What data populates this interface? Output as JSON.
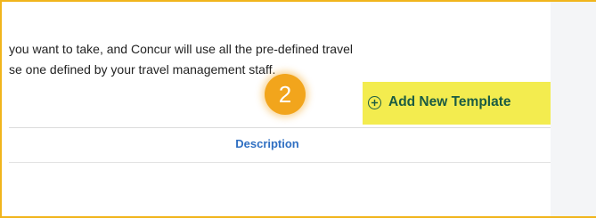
{
  "intro": {
    "line1": "you want to take, and Concur will use all the pre-defined travel",
    "line2": "se one defined by your travel management staff."
  },
  "step_badge": {
    "number": "2"
  },
  "toolbar": {
    "add_new_template_label": "Add New Template"
  },
  "table": {
    "columns": [
      "Description"
    ]
  },
  "colors": {
    "callout_yellow": "#f1b51c",
    "highlight_yellow": "#f3ec4f",
    "step_badge_orange": "#f2a51c",
    "button_green": "#1b5c43",
    "header_blue": "#2f6fc2"
  },
  "icons": {
    "add_button_icon": "plus-circle-icon"
  }
}
